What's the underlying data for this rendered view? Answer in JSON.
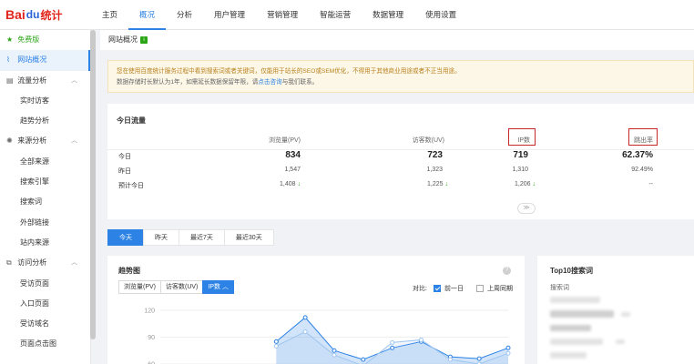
{
  "logo": {
    "bai": "Bai",
    "paw": "du",
    "tongji": "统计"
  },
  "nav": [
    {
      "label": "主页"
    },
    {
      "label": "概况"
    },
    {
      "label": "分析"
    },
    {
      "label": "用户管理"
    },
    {
      "label": "营销管理"
    },
    {
      "label": "智能运营"
    },
    {
      "label": "数据管理"
    },
    {
      "label": "使用设置"
    }
  ],
  "sidebar": {
    "free": "免费版",
    "overview": "网站概况",
    "traffic": "流量分析",
    "realtime": "实时访客",
    "trend": "趋势分析",
    "source": "来源分析",
    "all_source": "全部来源",
    "search_engine": "搜索引擎",
    "search_word": "搜索词",
    "external_link": "外部链接",
    "internal_source": "站内来源",
    "visit": "访问分析",
    "visited_page": "受访页面",
    "entry_page": "入口页面",
    "visited_domain": "受访域名",
    "page_heatmap": "页面点击图"
  },
  "breadcrumb": {
    "title": "网站概况",
    "badge": "i"
  },
  "notice": {
    "line1": "您在使用百度统计服务过程中看到搜索词或者关键词，仅能用于站长的SEO或SEM优化，不得用于其他商业用途或者不正当用途。",
    "line2_pre": "数据存储时长默认为1年，如需延长数据保留年限，请",
    "line2_link": "点击咨询",
    "line2_post": "与我们联系。"
  },
  "today": {
    "title": "今日流量",
    "columns": [
      "浏览量(PV)",
      "访客数(UV)",
      "IP数",
      "跳出率"
    ],
    "rows": [
      {
        "label": "今日",
        "pv": "834",
        "uv": "723",
        "ip": "719",
        "bounce": "62.37%"
      },
      {
        "label": "昨日",
        "pv": "1,547",
        "uv": "1,323",
        "ip": "1,310",
        "bounce": "92.49%"
      },
      {
        "label": "预计今日",
        "pv": "1,408",
        "uv": "1,225",
        "ip": "1,206",
        "bounce": "--"
      }
    ],
    "expand": "≫"
  },
  "range_tabs": [
    "今天",
    "昨天",
    "最近7天",
    "最近30天"
  ],
  "trend": {
    "title": "趋势图",
    "metrics": [
      "浏览量(PV)",
      "访客数(UV)",
      "IP数"
    ],
    "compare_label": "对比:",
    "compare_prev_day": "前一日",
    "compare_last_week": "上周同期",
    "info": "?"
  },
  "top10": {
    "title": "Top10搜索词",
    "col": "搜索词"
  },
  "chart_data": {
    "type": "area",
    "y_ticks": [
      "120",
      "90",
      "60"
    ],
    "ylim": [
      60,
      120
    ],
    "grid": true,
    "series": [
      {
        "values": [
          null,
          null,
          null,
          null,
          85,
          112,
          75,
          65,
          78,
          85,
          68,
          66,
          78
        ]
      },
      {
        "values": [
          null,
          null,
          null,
          null,
          80,
          96,
          70,
          58,
          84,
          87,
          65,
          60,
          72
        ]
      }
    ],
    "colors": {
      "primary": "#2c82e5",
      "secondary": "#9fc5f0"
    }
  },
  "colors": {
    "accent": "#2c82e5",
    "free": "#2aa515",
    "notice_bg": "#fdf7e7",
    "highlight_box": "#c62828"
  }
}
